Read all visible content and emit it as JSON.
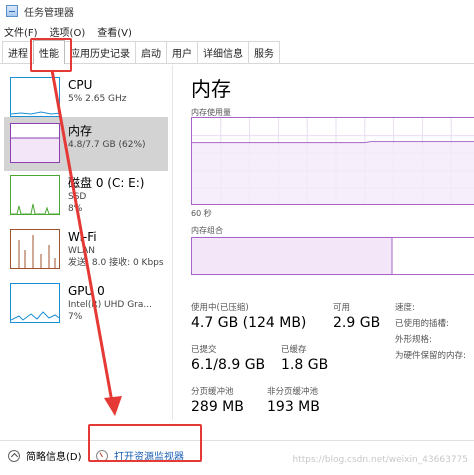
{
  "window": {
    "title": "任务管理器"
  },
  "menu": [
    "文件(F)",
    "选项(O)",
    "查看(V)"
  ],
  "tabs": [
    {
      "label": "进程",
      "active": false
    },
    {
      "label": "性能",
      "active": true
    },
    {
      "label": "应用历史记录",
      "active": false
    },
    {
      "label": "启动",
      "active": false
    },
    {
      "label": "用户",
      "active": false
    },
    {
      "label": "详细信息",
      "active": false
    },
    {
      "label": "服务",
      "active": false
    }
  ],
  "sidebar": {
    "items": [
      {
        "title": "CPU",
        "sub1": "5% 2.65 GHz",
        "sub2": "",
        "sub3": "",
        "color": "#1b8fd6"
      },
      {
        "title": "内存",
        "sub1": "4.8/7.7 GB (62%)",
        "sub2": "",
        "sub3": "",
        "color": "#8b3fb0"
      },
      {
        "title": "磁盘 0 (C: E:)",
        "sub1": "SSD",
        "sub2": "8%",
        "sub3": "",
        "color": "#4aa832"
      },
      {
        "title": "Wi-Fi",
        "sub1": "WLAN",
        "sub2": "发送: 8.0  接收: 0 Kbps",
        "sub3": "",
        "color": "#a0522d"
      },
      {
        "title": "GPU 0",
        "sub1": "Intel(R) UHD Gra...",
        "sub2": "7%",
        "sub3": "",
        "color": "#1b8fd6"
      }
    ]
  },
  "detail": {
    "title": "内存",
    "usage_label": "内存使用量",
    "time_label": "60 秒",
    "composition_label": "内存组合",
    "usage_graph_level": 0.72,
    "stats": {
      "in_use_label": "使用中(已压缩)",
      "in_use_value": "4.7 GB (124 MB)",
      "available_label": "可用",
      "available_value": "2.9 GB",
      "committed_label": "已提交",
      "committed_value": "6.1/8.9 GB",
      "cached_label": "已缓存",
      "cached_value": "1.8 GB",
      "paged_pool_label": "分页缓冲池",
      "paged_pool_value": "289 MB",
      "nonpaged_pool_label": "非分页缓冲池",
      "nonpaged_pool_value": "193 MB"
    },
    "right_info": [
      "速度:",
      "已使用的插槽:",
      "外形规格:",
      "为硬件保留的内存:"
    ]
  },
  "footer": {
    "summary_label": "简略信息(D)",
    "monitor_label": "打开资源监视器",
    "watermark": "https://blog.csdn.net/weixin_43663775"
  },
  "colors": {
    "memory_accent": "#a766c7",
    "annotation_red": "#e53935"
  }
}
